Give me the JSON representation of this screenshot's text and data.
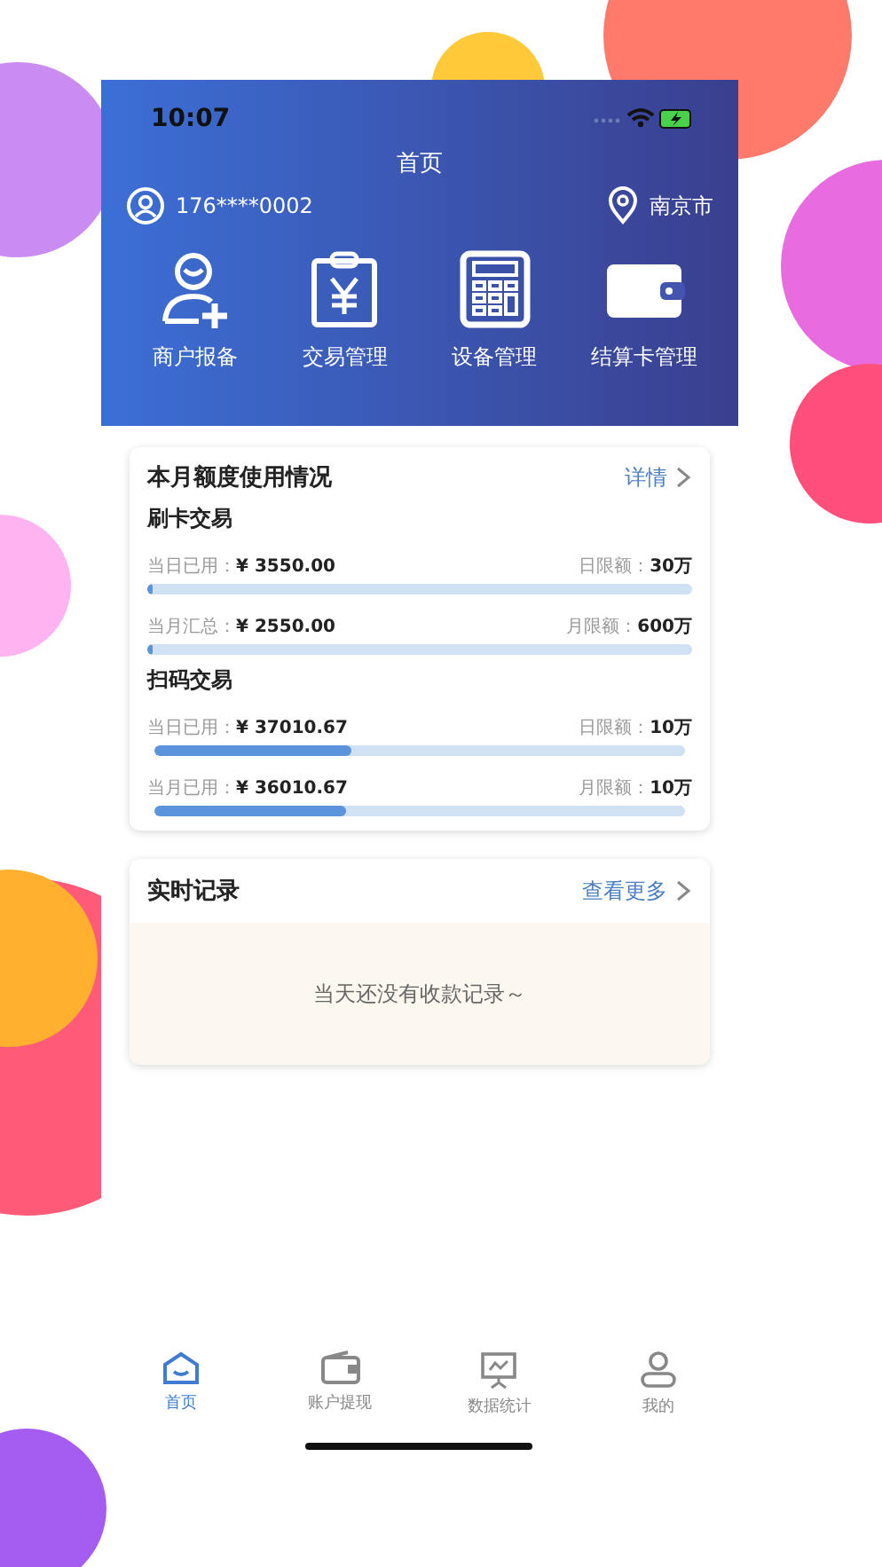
{
  "status_bar": {
    "time": "10:07"
  },
  "header": {
    "title": "首页",
    "account": "176****0002",
    "city": "南京市"
  },
  "shortcuts": [
    {
      "label": "商户报备",
      "kind": "merchant"
    },
    {
      "label": "交易管理",
      "kind": "trade"
    },
    {
      "label": "设备管理",
      "kind": "device"
    },
    {
      "label": "结算卡管理",
      "kind": "card"
    }
  ],
  "quota_card": {
    "title": "本月额度使用情况",
    "link": "详情",
    "sections": [
      {
        "title": "刷卡交易",
        "rows": [
          {
            "label": "当日已用：",
            "amount": "¥ 3550.00",
            "limit_label": "日限额：",
            "limit": "30万",
            "level": 0.01
          },
          {
            "label": "当月汇总：",
            "amount": "¥ 2550.00",
            "limit_label": "月限额：",
            "limit": "600万",
            "level": 0
          }
        ]
      },
      {
        "title": "扫码交易",
        "rows": [
          {
            "label": "当日已用：",
            "amount": "¥ 37010.67",
            "limit_label": "日限额：",
            "limit": "10万",
            "level": 0.37
          },
          {
            "label": "当月已用：",
            "amount": "¥ 36010.67",
            "limit_label": "月限额：",
            "limit": "10万",
            "level": 0.36
          }
        ]
      }
    ]
  },
  "records_card": {
    "title": "实时记录",
    "link": "查看更多",
    "empty": "当天还没有收款记录～"
  },
  "tab_bar": [
    {
      "label": "首页",
      "kind": "home",
      "selected": true
    },
    {
      "label": "账户提现",
      "kind": "wallet",
      "selected": false
    },
    {
      "label": "数据统计",
      "kind": "stats",
      "selected": false
    },
    {
      "label": "我的",
      "kind": "profile",
      "selected": false
    }
  ]
}
